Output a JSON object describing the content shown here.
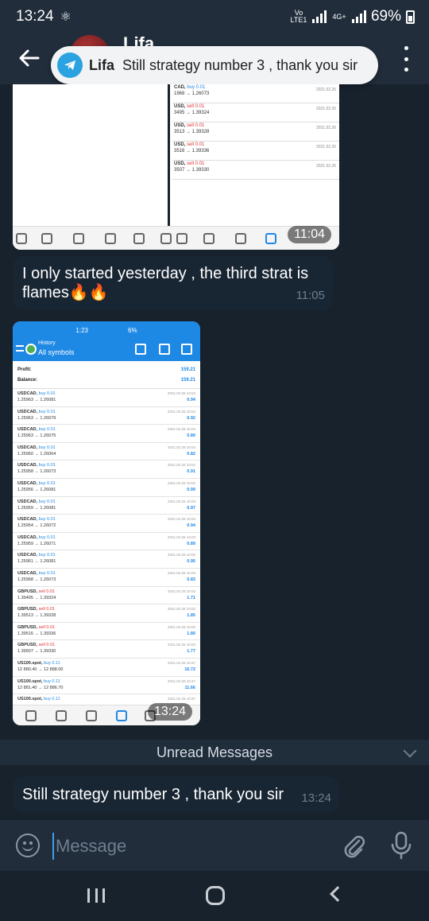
{
  "status_bar": {
    "time": "13:24",
    "volte": "Vo LTE1",
    "network": "4G+",
    "battery": "69%"
  },
  "header": {
    "contact_name": "Lifa"
  },
  "notification": {
    "app_icon": "telegram-icon",
    "sender": "Lifa",
    "text": "Still strategy number 3 , thank you sir"
  },
  "image1": {
    "rows": [
      {
        "sym": "CAD,",
        "type": "buy 0.01",
        "side": "buy",
        "prices": "1968 → 1.26073",
        "date": "2021.02.26"
      },
      {
        "sym": "USD,",
        "type": "sell 0.01",
        "side": "sell",
        "prices": "3495 → 1.39324",
        "date": "2021.02.26"
      },
      {
        "sym": "USD,",
        "type": "sell 0.01",
        "side": "sell",
        "prices": "3513 → 1.39328",
        "date": "2021.02.26"
      },
      {
        "sym": "USD,",
        "type": "sell 0.01",
        "side": "sell",
        "prices": "3516 → 1.39336",
        "date": "2021.02.26"
      },
      {
        "sym": "USD,",
        "type": "sell 0.01",
        "side": "sell",
        "prices": "3507 → 1.39330",
        "date": "2021.02.26"
      }
    ],
    "time": "11:04"
  },
  "message1": {
    "text": "I only started yesterday , the third strat is flames🔥🔥",
    "time": "11:05"
  },
  "image2": {
    "phone_time": "1:23",
    "phone_battery": "6%",
    "title": "History",
    "subtitle": "All symbols",
    "profit_label": "Profit:",
    "profit_value": "159.21",
    "balance_label": "Balance:",
    "balance_value": "159.21",
    "deals": [
      {
        "sym": "USDCAD,",
        "type": "buy 0.01",
        "side": "buy",
        "prices": "1.25963 → 1.26081",
        "date": "2021.02.26 10:04",
        "profit": "0.94"
      },
      {
        "sym": "USDCAD,",
        "type": "buy 0.01",
        "side": "buy",
        "prices": "1.25963 → 1.26079",
        "date": "2021.02.26 10:04",
        "profit": "0.92"
      },
      {
        "sym": "USDCAD,",
        "type": "buy 0.01",
        "side": "buy",
        "prices": "1.25963 → 1.26075",
        "date": "2021.02.26 10:04",
        "profit": "0.89"
      },
      {
        "sym": "USDCAD,",
        "type": "buy 0.01",
        "side": "buy",
        "prices": "1.25960 → 1.26064",
        "date": "2021.02.26 10:04",
        "profit": "0.82"
      },
      {
        "sym": "USDCAD,",
        "type": "buy 0.01",
        "side": "buy",
        "prices": "1.25958 → 1.26073",
        "date": "2021.02.26 10:04",
        "profit": "0.91"
      },
      {
        "sym": "USDCAD,",
        "type": "buy 0.01",
        "side": "buy",
        "prices": "1.25956 → 1.26081",
        "date": "2021.02.26 10:03",
        "profit": "0.99"
      },
      {
        "sym": "USDCAD,",
        "type": "buy 0.01",
        "side": "buy",
        "prices": "1.25959 → 1.26081",
        "date": "2021.02.26 10:03",
        "profit": "0.97"
      },
      {
        "sym": "USDCAD,",
        "type": "buy 0.01",
        "side": "buy",
        "prices": "1.25954 → 1.26072",
        "date": "2021.02.26 10:03",
        "profit": "0.94"
      },
      {
        "sym": "USDCAD,",
        "type": "buy 0.01",
        "side": "buy",
        "prices": "1.25959 → 1.26071",
        "date": "2021.02.26 10:03",
        "profit": "0.89"
      },
      {
        "sym": "USDCAD,",
        "type": "buy 0.01",
        "side": "buy",
        "prices": "1.25961 → 1.26081",
        "date": "2021.02.26 10:03",
        "profit": "0.95"
      },
      {
        "sym": "USDCAD,",
        "type": "buy 0.01",
        "side": "buy",
        "prices": "1.25968 → 1.26073",
        "date": "2021.02.26 10:03",
        "profit": "0.83"
      },
      {
        "sym": "GBPUSD,",
        "type": "sell 0.01",
        "side": "sell",
        "prices": "1.39495 → 1.39324",
        "date": "2021.02.26 10:03",
        "profit": "1.71"
      },
      {
        "sym": "GBPUSD,",
        "type": "sell 0.01",
        "side": "sell",
        "prices": "1.39513 → 1.39328",
        "date": "2021.02.26 10:03",
        "profit": "1.85"
      },
      {
        "sym": "GBPUSD,",
        "type": "sell 0.01",
        "side": "sell",
        "prices": "1.39516 → 1.39336",
        "date": "2021.02.26 10:03",
        "profit": "1.80"
      },
      {
        "sym": "GBPUSD,",
        "type": "sell 0.01",
        "side": "sell",
        "prices": "1.39507 → 1.39330",
        "date": "2021.02.26 10:02",
        "profit": "1.77"
      },
      {
        "sym": "US100.spot,",
        "type": "buy 0.11",
        "side": "buy",
        "prices": "12 880.40 → 12 888.00",
        "date": "2021.02.26 10:47",
        "profit": "16.72"
      },
      {
        "sym": "US100.spot,",
        "type": "buy 0.11",
        "side": "buy",
        "prices": "12 881.40 → 12 886.70",
        "date": "2021.02.26 10:47",
        "profit": "11.66"
      },
      {
        "sym": "US100.spot,",
        "type": "buy 0.11",
        "side": "buy",
        "prices": "",
        "date": "2021.02.26 10:47",
        "profit": ""
      }
    ],
    "time": "13:24"
  },
  "unread_banner": "Unread Messages",
  "message2": {
    "text": "Still strategy number 3 , thank you sir",
    "time": "13:24"
  },
  "input": {
    "placeholder": "Message"
  },
  "colors": {
    "background": "#18222d",
    "header": "#212d3b",
    "bubble": "#182533",
    "accent": "#2aa3e0",
    "mt_blue": "#1e88e5",
    "sell_red": "#d33333"
  }
}
